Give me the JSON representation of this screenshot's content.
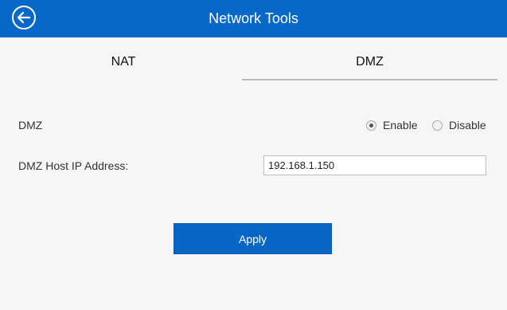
{
  "header": {
    "title": "Network Tools",
    "back_icon": "back-arrow-icon"
  },
  "tabs": [
    {
      "label": "NAT",
      "active": false
    },
    {
      "label": "DMZ",
      "active": true
    }
  ],
  "dmz": {
    "label": "DMZ",
    "options": [
      {
        "label": "Enable",
        "selected": true
      },
      {
        "label": "Disable",
        "selected": false
      }
    ]
  },
  "host_ip": {
    "label": "DMZ Host IP Address:",
    "value": "192.168.1.150"
  },
  "apply_label": "Apply",
  "colors": {
    "header": "#0868c8",
    "button": "#0867c6",
    "background": "#f6f6f6"
  }
}
